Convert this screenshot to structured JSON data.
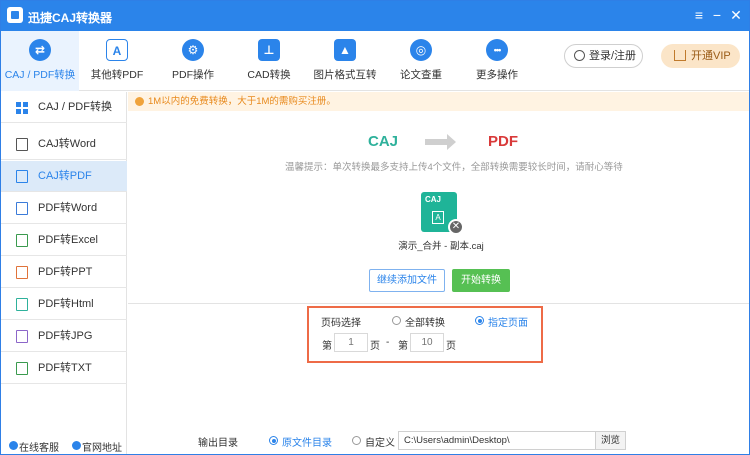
{
  "window": {
    "title": "迅捷CAJ转换器",
    "menu_glyph": "≡",
    "minimize_glyph": "−",
    "close_glyph": "✕"
  },
  "toolbar": {
    "tools": [
      {
        "label": "CAJ / PDF转换",
        "icon": "convert-arrows-icon",
        "glyph": "⇄"
      },
      {
        "label": "其他转PDF",
        "icon": "pdf-icon",
        "glyph": "A"
      },
      {
        "label": "PDF操作",
        "icon": "gear-icon",
        "glyph": "⚙"
      },
      {
        "label": "CAD转换",
        "icon": "cad-icon",
        "glyph": "⊥"
      },
      {
        "label": "图片格式互转",
        "icon": "image-icon",
        "glyph": "▲"
      },
      {
        "label": "论文查重",
        "icon": "search-doc-icon",
        "glyph": "◎"
      },
      {
        "label": "更多操作",
        "icon": "more-icon",
        "glyph": "•••"
      }
    ],
    "login_label": "登录/注册",
    "vip_label": "开通VIP"
  },
  "sidebar": {
    "items": [
      {
        "label": "CAJ / PDF转换"
      },
      {
        "label": "CAJ转Word"
      },
      {
        "label": "CAJ转PDF"
      },
      {
        "label": "PDF转Word"
      },
      {
        "label": "PDF转Excel"
      },
      {
        "label": "PDF转PPT"
      },
      {
        "label": "PDF转Html"
      },
      {
        "label": "PDF转JPG"
      },
      {
        "label": "PDF转TXT"
      }
    ],
    "footer": {
      "service": "在线客服",
      "website": "官网地址"
    }
  },
  "notice": "1M以内的免费转换，大于1M的需购买注册。",
  "conversion": {
    "from": "CAJ",
    "to": "PDF",
    "tip": "温馨提示：单次转换最多支持上传4个文件，全部转换需要较长时间，请耐心等待"
  },
  "file": {
    "type": "CAJ",
    "name": "演示_合并 - 副本.caj",
    "delete_glyph": "✕"
  },
  "buttons": {
    "add_files": "继续添加文件",
    "start": "开始转换"
  },
  "page_select": {
    "title": "页码选择",
    "all_label": "全部转换",
    "range_label": "指定页面",
    "from_prefix": "第",
    "page_unit": "页",
    "dash": "-",
    "from_placeholder": "1",
    "to_placeholder": "10"
  },
  "output": {
    "label": "输出目录",
    "original_label": "原文件目录",
    "custom_label": "自定义",
    "path": "C:\\Users\\admin\\Desktop\\",
    "browse_label": "浏览"
  }
}
